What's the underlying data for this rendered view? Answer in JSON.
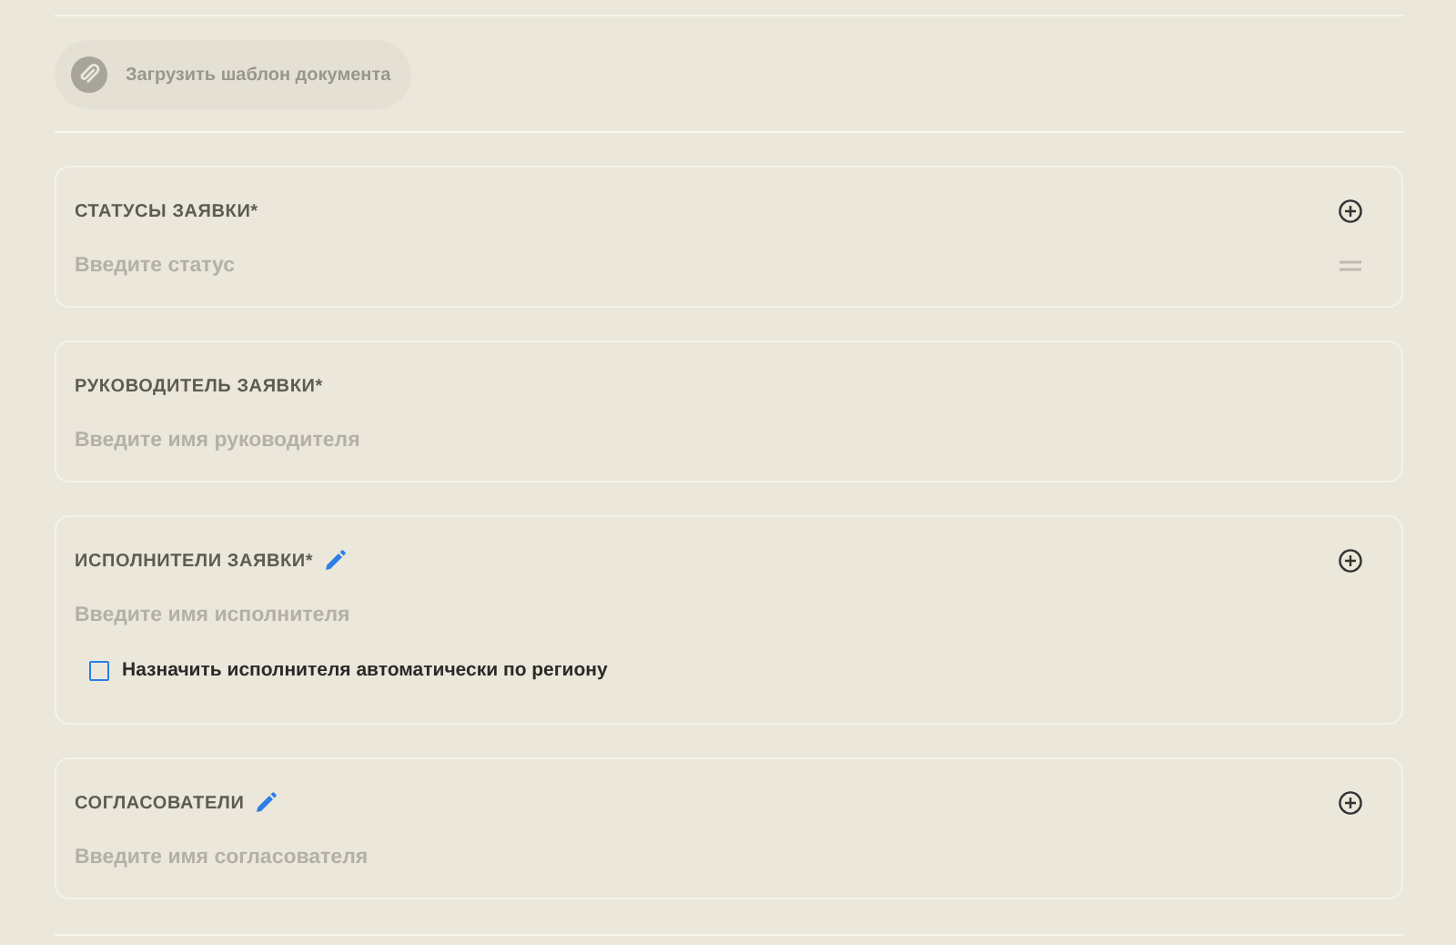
{
  "upload_button": {
    "label": "Загрузить шаблон документа"
  },
  "sections": [
    {
      "title": "СТАТУСЫ ЗАЯВКИ*",
      "editable": false,
      "addable": true,
      "reorderable": true,
      "placeholder": "Введите статус"
    },
    {
      "title": "РУКОВОДИТЕЛЬ ЗАЯВКИ*",
      "editable": false,
      "addable": false,
      "reorderable": false,
      "placeholder": "Введите имя руководителя"
    },
    {
      "title": "ИСПОЛНИТЕЛИ ЗАЯВКИ*",
      "editable": true,
      "addable": true,
      "reorderable": false,
      "placeholder": "Введите имя исполнителя",
      "checkbox": {
        "label": "Назначить исполнителя автоматически по региону",
        "checked": false
      }
    },
    {
      "title": "СОГЛАСОВАТЕЛИ",
      "editable": true,
      "addable": true,
      "reorderable": false,
      "placeholder": "Введите имя согласователя"
    }
  ]
}
